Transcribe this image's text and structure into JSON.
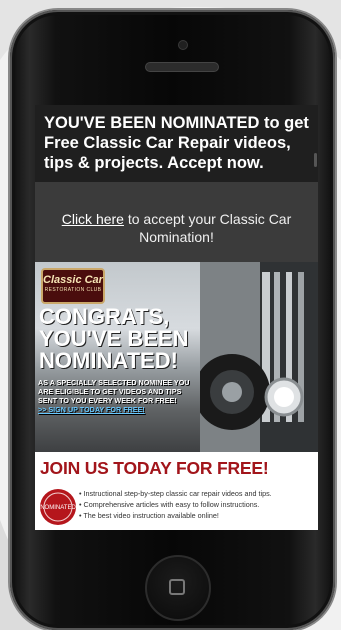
{
  "header": {
    "text": "YOU'VE BEEN NOMINATED to get Free Classic Car Repair videos, tips & projects. Accept now."
  },
  "accept": {
    "link_text": "Click here",
    "rest_text": " to accept your Classic Car Nomination!"
  },
  "ad": {
    "logo_line1": "Classic Car",
    "logo_line2": "RESTORATION CLUB",
    "headline": "CONGRATS, YOU'VE BEEN NOMINATED!",
    "body": "AS A SPECIALLY SELECTED NOMINEE YOU ARE ELIGIBLE TO GET VIDEOS AND TIPS SENT TO YOU EVERY WEEK FOR FREE!",
    "signup": ">> SIGN UP TODAY FOR FREE!"
  },
  "join": {
    "title": "JOIN US TODAY FOR FREE!",
    "seal_text": "NOMINATED",
    "bullets": [
      "Instructional step-by-step classic car repair videos and tips.",
      "Comprehensive articles with easy to follow instructions.",
      "The best video instruction available online!"
    ]
  },
  "colors": {
    "join_title": "#a2151b",
    "signup": "#67c8ff",
    "logo_bg": "#4a0d0d"
  }
}
